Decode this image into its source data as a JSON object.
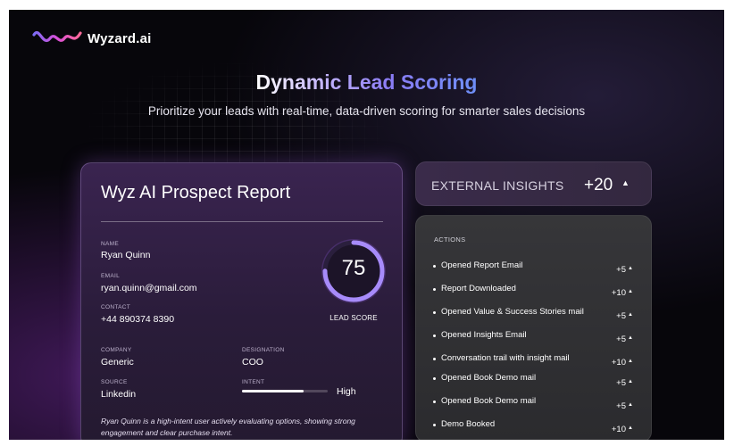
{
  "brand": {
    "name": "Wyzard.ai",
    "logo_icon": "wyzard-wave-logo"
  },
  "hero": {
    "title": "Dynamic Lead Scoring",
    "subtitle": "Prioritize your leads with real-time, data-driven scoring for smarter sales decisions"
  },
  "report": {
    "title": "Wyz AI Prospect Report",
    "name_label": "NAME",
    "name": "Ryan Quinn",
    "email_label": "EMAIL",
    "email": "ryan.quinn@gmail.com",
    "contact_label": "CONTACT",
    "contact": "+44 890374 8390",
    "company_label": "COMPANY",
    "company": "Generic",
    "designation_label": "DESIGNATION",
    "designation": "COO",
    "source_label": "SOURCE",
    "source": "Linkedin",
    "intent_label": "INTENT",
    "intent_value": "High",
    "intent_level": 0.72,
    "score": "75",
    "score_fraction": 0.75,
    "score_label": "LEAD SCORE",
    "summary": "Ryan Quinn is a high-intent user actively evaluating options, showing strong engagement and clear purchase intent."
  },
  "insights": {
    "label": "EXTERNAL INSIGHTS",
    "score": "+20",
    "caret": "▲"
  },
  "actions": {
    "heading": "ACTIONS",
    "items": [
      {
        "label": "Opened Report Email",
        "score": "+5"
      },
      {
        "label": "Report Downloaded",
        "score": "+10"
      },
      {
        "label": "Opened Value & Success Stories mail",
        "score": "+5"
      },
      {
        "label": "Opened Insights Email",
        "score": "+5"
      },
      {
        "label": "Conversation trail with insight mail",
        "score": "+10"
      },
      {
        "label": "Opened Book Demo mail",
        "score": "+5"
      },
      {
        "label": "Opened Book Demo mail",
        "score": "+5"
      },
      {
        "label": "Demo Booked",
        "score": "+10"
      }
    ],
    "caret": "▲"
  },
  "colors": {
    "accent": "#a78bfa",
    "gauge_track": "#2a1f3d",
    "background": "#07060b"
  }
}
